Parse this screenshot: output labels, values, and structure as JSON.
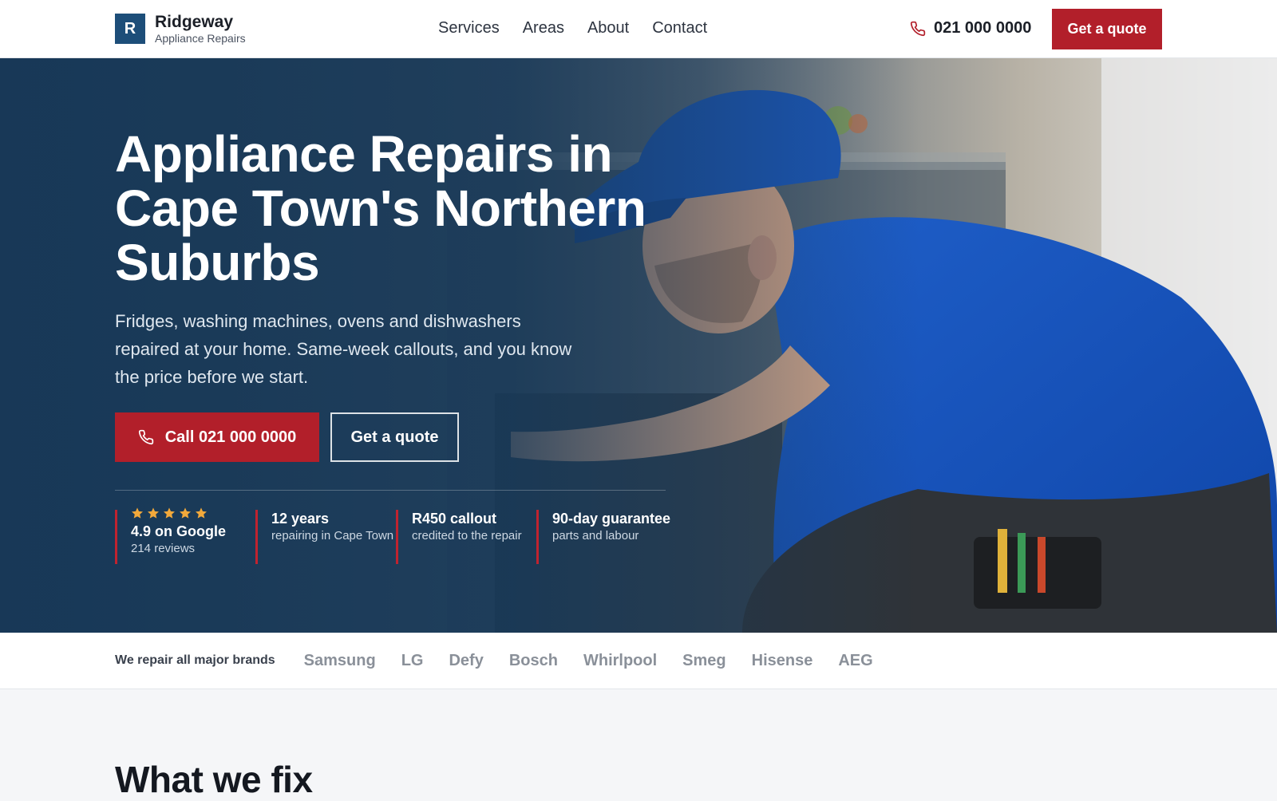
{
  "header": {
    "logo_letter": "R",
    "brand_name": "Ridgeway",
    "brand_sub": "Appliance Repairs",
    "nav": [
      "Services",
      "Areas",
      "About",
      "Contact"
    ],
    "phone": "021 000 0000",
    "cta": "Get a quote"
  },
  "hero": {
    "title": "Appliance Repairs in Cape Town's Northern Suburbs",
    "subtitle": "Fridges, washing machines, ovens and dishwashers repaired at your home. Same-week callouts, and you know the price before we start.",
    "call_button": "Call 021 000 0000",
    "quote_button": "Get a quote",
    "stats": [
      {
        "title": "4.9 on Google",
        "desc": "214 reviews",
        "stars": 5
      },
      {
        "title": "12 years",
        "desc": "repairing in Cape Town"
      },
      {
        "title": "R450 callout",
        "desc": "credited to the repair"
      },
      {
        "title": "90-day guarantee",
        "desc": "parts and labour"
      }
    ]
  },
  "brands": {
    "label": "We repair all major brands",
    "items": [
      "Samsung",
      "LG",
      "Defy",
      "Bosch",
      "Whirlpool",
      "Smeg",
      "Hisense",
      "AEG"
    ]
  },
  "section": {
    "title": "What we fix"
  },
  "colors": {
    "brand_blue": "#1d4e79",
    "accent_red": "#b21f2a",
    "star": "#f2a93b"
  }
}
